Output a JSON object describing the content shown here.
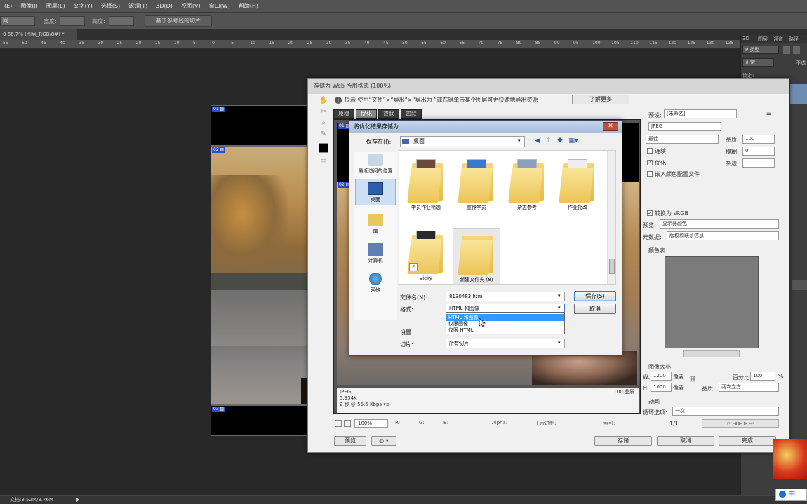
{
  "menubar": [
    "(E)",
    "图像(I)",
    "图层(L)",
    "文字(Y)",
    "选择(S)",
    "滤镜(T)",
    "3D(D)",
    "视图(V)",
    "窗口(W)",
    "帮助(H)"
  ],
  "options": {
    "tool_select": "同",
    "width_label": "宽度:",
    "height_label": "高度:",
    "guides_button": "基于参考线的切片"
  },
  "doc_tab": "0 66.7% (图层_RGB/8#) *",
  "ruler_ticks": [
    "55",
    "50",
    "45",
    "40",
    "35",
    "30",
    "25",
    "20",
    "15",
    "10",
    "5",
    "0",
    "5",
    "10",
    "15",
    "20",
    "25",
    "30",
    "35",
    "40",
    "45",
    "50",
    "55",
    "60",
    "65",
    "70",
    "75",
    "80",
    "85",
    "90",
    "95",
    "100",
    "105",
    "110",
    "115",
    "120",
    "125",
    "130",
    "135"
  ],
  "slices": [
    "01 ▨",
    "02 ▨",
    "03 ▨"
  ],
  "status": "文档:3.52M/3.76M",
  "right_panel": {
    "tabs": [
      "3D",
      "图层",
      "通道",
      "路径"
    ],
    "kind": "P 类型",
    "blend": "正常",
    "opacity": "不透",
    "lock": "锁定:"
  },
  "sfw": {
    "title": "存储为 Web 所用格式 (100%)",
    "hint": "提示   使用“文件”>“导出”>“导出为   ”或右键单击某个图层可更快速地导出资源",
    "learn_more": "了解更多",
    "view_tabs": [
      "原稿",
      "优化",
      "双联",
      "四联"
    ],
    "preview_info": [
      "JPEG",
      "5.954K",
      "2 秒 @ 56.6 Kbps  ▾≡"
    ],
    "preview_quality": "100 品质",
    "zoom": "100%",
    "zoom_fields": [
      "R:",
      "G:",
      "B:",
      "Alpha:",
      "十六进制:",
      "索引:"
    ],
    "bottom_buttons": {
      "preview": "预览",
      "save": "存储",
      "cancel": "取消",
      "done": "完成"
    },
    "preset_label": "预设:",
    "preset_value": "[未命名]",
    "format": "JPEG",
    "quality_mode": "最佳",
    "quality_label": "品质:",
    "quality_value": "100",
    "progressive": "连续",
    "blur_label": "模糊:",
    "blur_value": "0",
    "optimize": "优化",
    "matte_label": "杂边:",
    "embed_profile": "嵌入颜色配置文件",
    "convert_srgb": "转换为 sRGB",
    "preview_label": "预览:",
    "preview_value": "显示器颜色",
    "metadata_label": "元数据:",
    "metadata_value": "版权和联系信息",
    "color_table": "颜色表",
    "image_size": "图像大小",
    "w_label": "W:",
    "w_value": "1200",
    "h_label": "H:",
    "h_value": "1000",
    "px": "像素",
    "percent_label": "百分比:",
    "percent_value": "100",
    "percent_unit": "%",
    "quality2_label": "品质:",
    "quality2_value": "两次立方",
    "anim": "动画",
    "loop_label": "循环选项:",
    "loop_value": "一次",
    "frame": "1/1"
  },
  "save_dialog": {
    "title": "将优化结果存储为",
    "save_in_label": "保存在(I):",
    "save_in_value": "桌面",
    "places": [
      "最近访问的位置",
      "桌面",
      "库",
      "计算机",
      "网络"
    ],
    "folders": [
      "学员作业筛选",
      "宣传学员",
      "杂志参考",
      "作业批改",
      "vicky",
      "新建文件夹 (8)"
    ],
    "filename_label": "文件名(N):",
    "filename_value": "8130483.html",
    "format_label": "格式:",
    "format_value": "HTML 和图像",
    "format_options": [
      "HTML 和图像",
      "仅限图像",
      "仅限 HTML"
    ],
    "settings_label": "设置:",
    "slices_label": "切片:",
    "slices_value": "所有切片",
    "save_button": "保存(S)",
    "cancel_button": "取消"
  },
  "ime": "中"
}
